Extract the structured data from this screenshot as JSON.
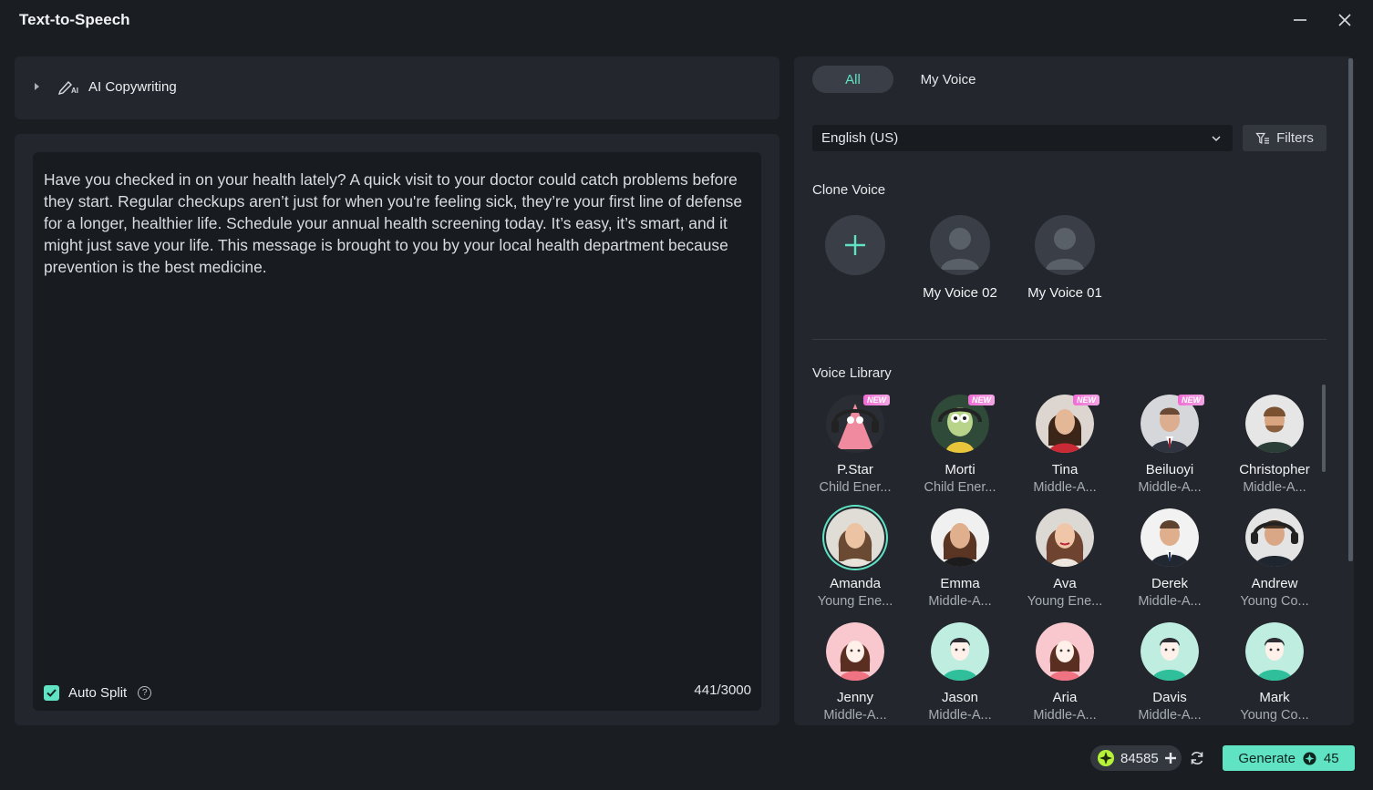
{
  "window": {
    "title": "Text-to-Speech"
  },
  "ai_copywriting": {
    "label": "AI Copywriting"
  },
  "editor": {
    "text": "Have you checked in on your health lately? A quick visit to your doctor could catch problems before they start. Regular checkups aren’t just for when you're feeling sick, they’re your first line of defense for a longer, healthier life. Schedule your annual health screening today. It’s easy, it’s smart, and it might just save your life. This message is brought to you by your local health department because prevention is the best medicine.",
    "auto_split_label": "Auto Split",
    "auto_split_checked": true,
    "char_count": "441/3000"
  },
  "voice_panel": {
    "tabs": [
      {
        "label": "All",
        "active": true
      },
      {
        "label": "My Voice",
        "active": false
      }
    ],
    "language": "English (US)",
    "filters_label": "Filters",
    "clone_voice_label": "Clone Voice",
    "clone_voices": [
      {
        "name": "My Voice 02"
      },
      {
        "name": "My Voice 01"
      }
    ],
    "voice_library_label": "Voice Library",
    "new_badge": "NEW",
    "voices": [
      {
        "name": "P.Star",
        "desc": "Child Ener...",
        "new": true
      },
      {
        "name": "Morti",
        "desc": "Child Ener...",
        "new": true
      },
      {
        "name": "Tina",
        "desc": "Middle-A...",
        "new": true
      },
      {
        "name": "Beiluoyi",
        "desc": "Middle-A...",
        "new": true
      },
      {
        "name": "Christopher",
        "desc": "Middle-A...",
        "new": false
      },
      {
        "name": "Amanda",
        "desc": "Young Ene...",
        "new": false,
        "selected": true
      },
      {
        "name": "Emma",
        "desc": "Middle-A...",
        "new": false
      },
      {
        "name": "Ava",
        "desc": "Young Ene...",
        "new": false
      },
      {
        "name": "Derek",
        "desc": "Middle-A...",
        "new": false
      },
      {
        "name": "Andrew",
        "desc": "Young Co...",
        "new": false
      },
      {
        "name": "Jenny",
        "desc": "Middle-A...",
        "new": false
      },
      {
        "name": "Jason",
        "desc": "Middle-A...",
        "new": false
      },
      {
        "name": "Aria",
        "desc": "Middle-A...",
        "new": false
      },
      {
        "name": "Davis",
        "desc": "Middle-A...",
        "new": false
      },
      {
        "name": "Mark",
        "desc": "Young Co...",
        "new": false
      }
    ]
  },
  "footer": {
    "credits": "84585",
    "generate_label": "Generate",
    "generate_cost": "45"
  },
  "colors": {
    "accent": "#5fe3c3",
    "panel": "#23272d",
    "background": "#1a1d22",
    "new_badge": "#f06bd4"
  }
}
